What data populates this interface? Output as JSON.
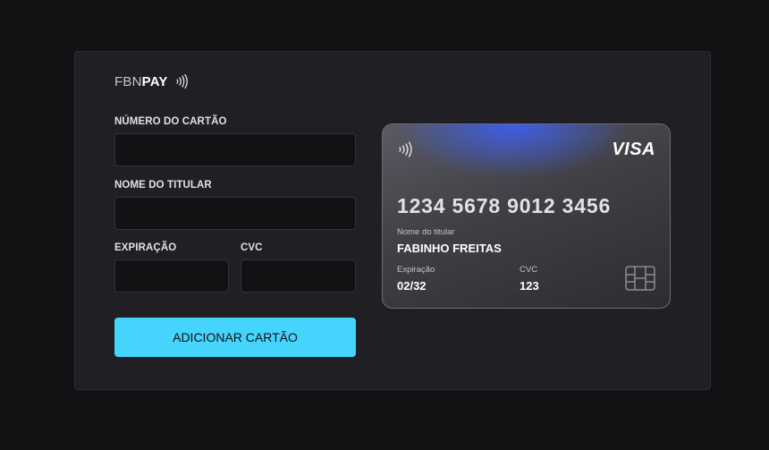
{
  "logo": {
    "part1": "FBN",
    "part2": "PAY"
  },
  "form": {
    "card_number_label": "NÚMERO DO CARTÃO",
    "card_number_value": "",
    "holder_label": "NOME DO TITULAR",
    "holder_value": "",
    "expiration_label": "EXPIRAÇÃO",
    "expiration_value": "",
    "cvc_label": "CVC",
    "cvc_value": "",
    "submit_label": "ADICIONAR CARTÃO"
  },
  "card": {
    "brand": "VISA",
    "number": "1234 5678 9012 3456",
    "holder_caption": "Nome do titular",
    "holder_name": "FABINHO FREITAS",
    "expiration_caption": "Expiração",
    "expiration_value": "02/32",
    "cvc_caption": "CVC",
    "cvc_value": "123"
  },
  "colors": {
    "background": "#121214",
    "panel": "#202024",
    "accent": "#45d4fc",
    "card_glow": "#3d5ee8"
  },
  "icons": [
    "contactless-icon",
    "card-contactless-icon",
    "card-chip-icon"
  ]
}
